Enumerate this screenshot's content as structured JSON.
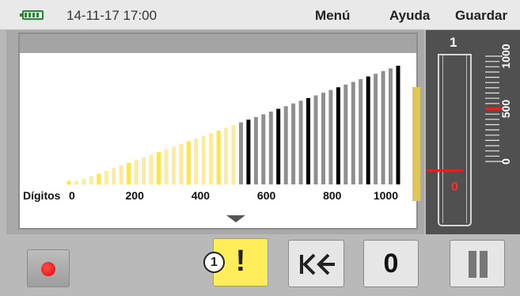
{
  "topbar": {
    "datetime": "14-11-17 17:00",
    "menu_label": "Menú",
    "help_label": "Ayuda",
    "save_label": "Guardar",
    "battery_icon": "battery-icon"
  },
  "chart": {
    "ylabel": "Dígitos",
    "tick_labels": [
      "0",
      "200",
      "400",
      "600",
      "800",
      "1000"
    ],
    "scroll_icon": "triangle-down-icon"
  },
  "chart_data": {
    "type": "bar",
    "x_range": [
      0,
      1000
    ],
    "y_range": [
      0,
      1000
    ],
    "bar_count": 45,
    "threshold_value": 500,
    "colors": {
      "below_threshold": "#fdeb9e",
      "below_threshold_accent": "#ffe350",
      "above_threshold": "#8f8f8f",
      "above_threshold_accent": "#000000"
    }
  },
  "gauge": {
    "channel_number": "1",
    "value": "0",
    "level": 0,
    "scale_labels": [
      "1000",
      "500",
      "0"
    ],
    "range": [
      0,
      1000
    ],
    "marker_value": 500,
    "level_color": "#e22222"
  },
  "bottombar": {
    "record_icon": "record-icon",
    "alert_label": "!",
    "alert_badge": "1",
    "back_icon": "skip-back-icon",
    "zero_label": "0",
    "pause_icon": "pause-icon",
    "alert_color": "#ffee5a"
  }
}
